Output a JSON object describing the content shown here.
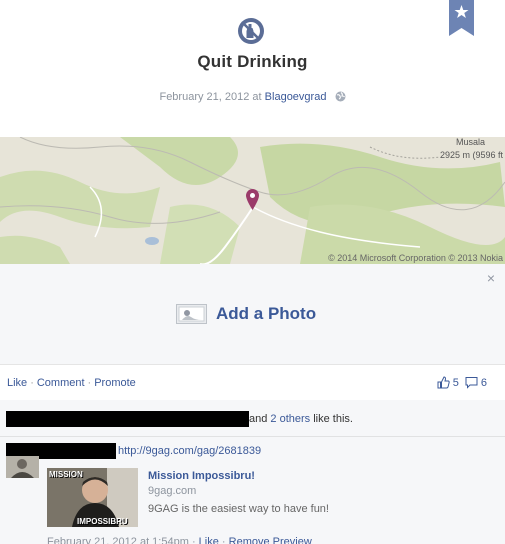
{
  "event": {
    "title": "Quit Drinking",
    "date": "February 21, 2012",
    "at_word": "at",
    "location": "Blagoevgrad"
  },
  "map": {
    "peak_label": "Musala",
    "elevation_label": "2925 m (9596 ft",
    "copyright": "© 2014 Microsoft Corporation © 2013 Nokia"
  },
  "photo_prompt": {
    "label": "Add a Photo",
    "close": "×"
  },
  "actions": {
    "like": "Like",
    "comment": "Comment",
    "promote": "Promote",
    "separator": "·",
    "like_count": "5",
    "comment_count": "6"
  },
  "likes_sentence": {
    "and": "and",
    "others": "2 others",
    "suffix": "like this."
  },
  "comment": {
    "link": "http://9gag.com/gag/2681839",
    "preview_title": "Mission Impossibru!",
    "preview_domain": "9gag.com",
    "preview_description": "9GAG is the easiest way to have fun!",
    "thumb_text_top": "MISSION",
    "thumb_text_bottom": "IMPOSSIBRU",
    "footer_date": "February 21, 2012 at 1:54pm",
    "footer_like": "Like",
    "footer_remove": "Remove Preview"
  },
  "colors": {
    "link": "#3b5998",
    "muted": "#8d949e",
    "bookmark": "#6d84b4",
    "pin": "#9b3b6a"
  }
}
